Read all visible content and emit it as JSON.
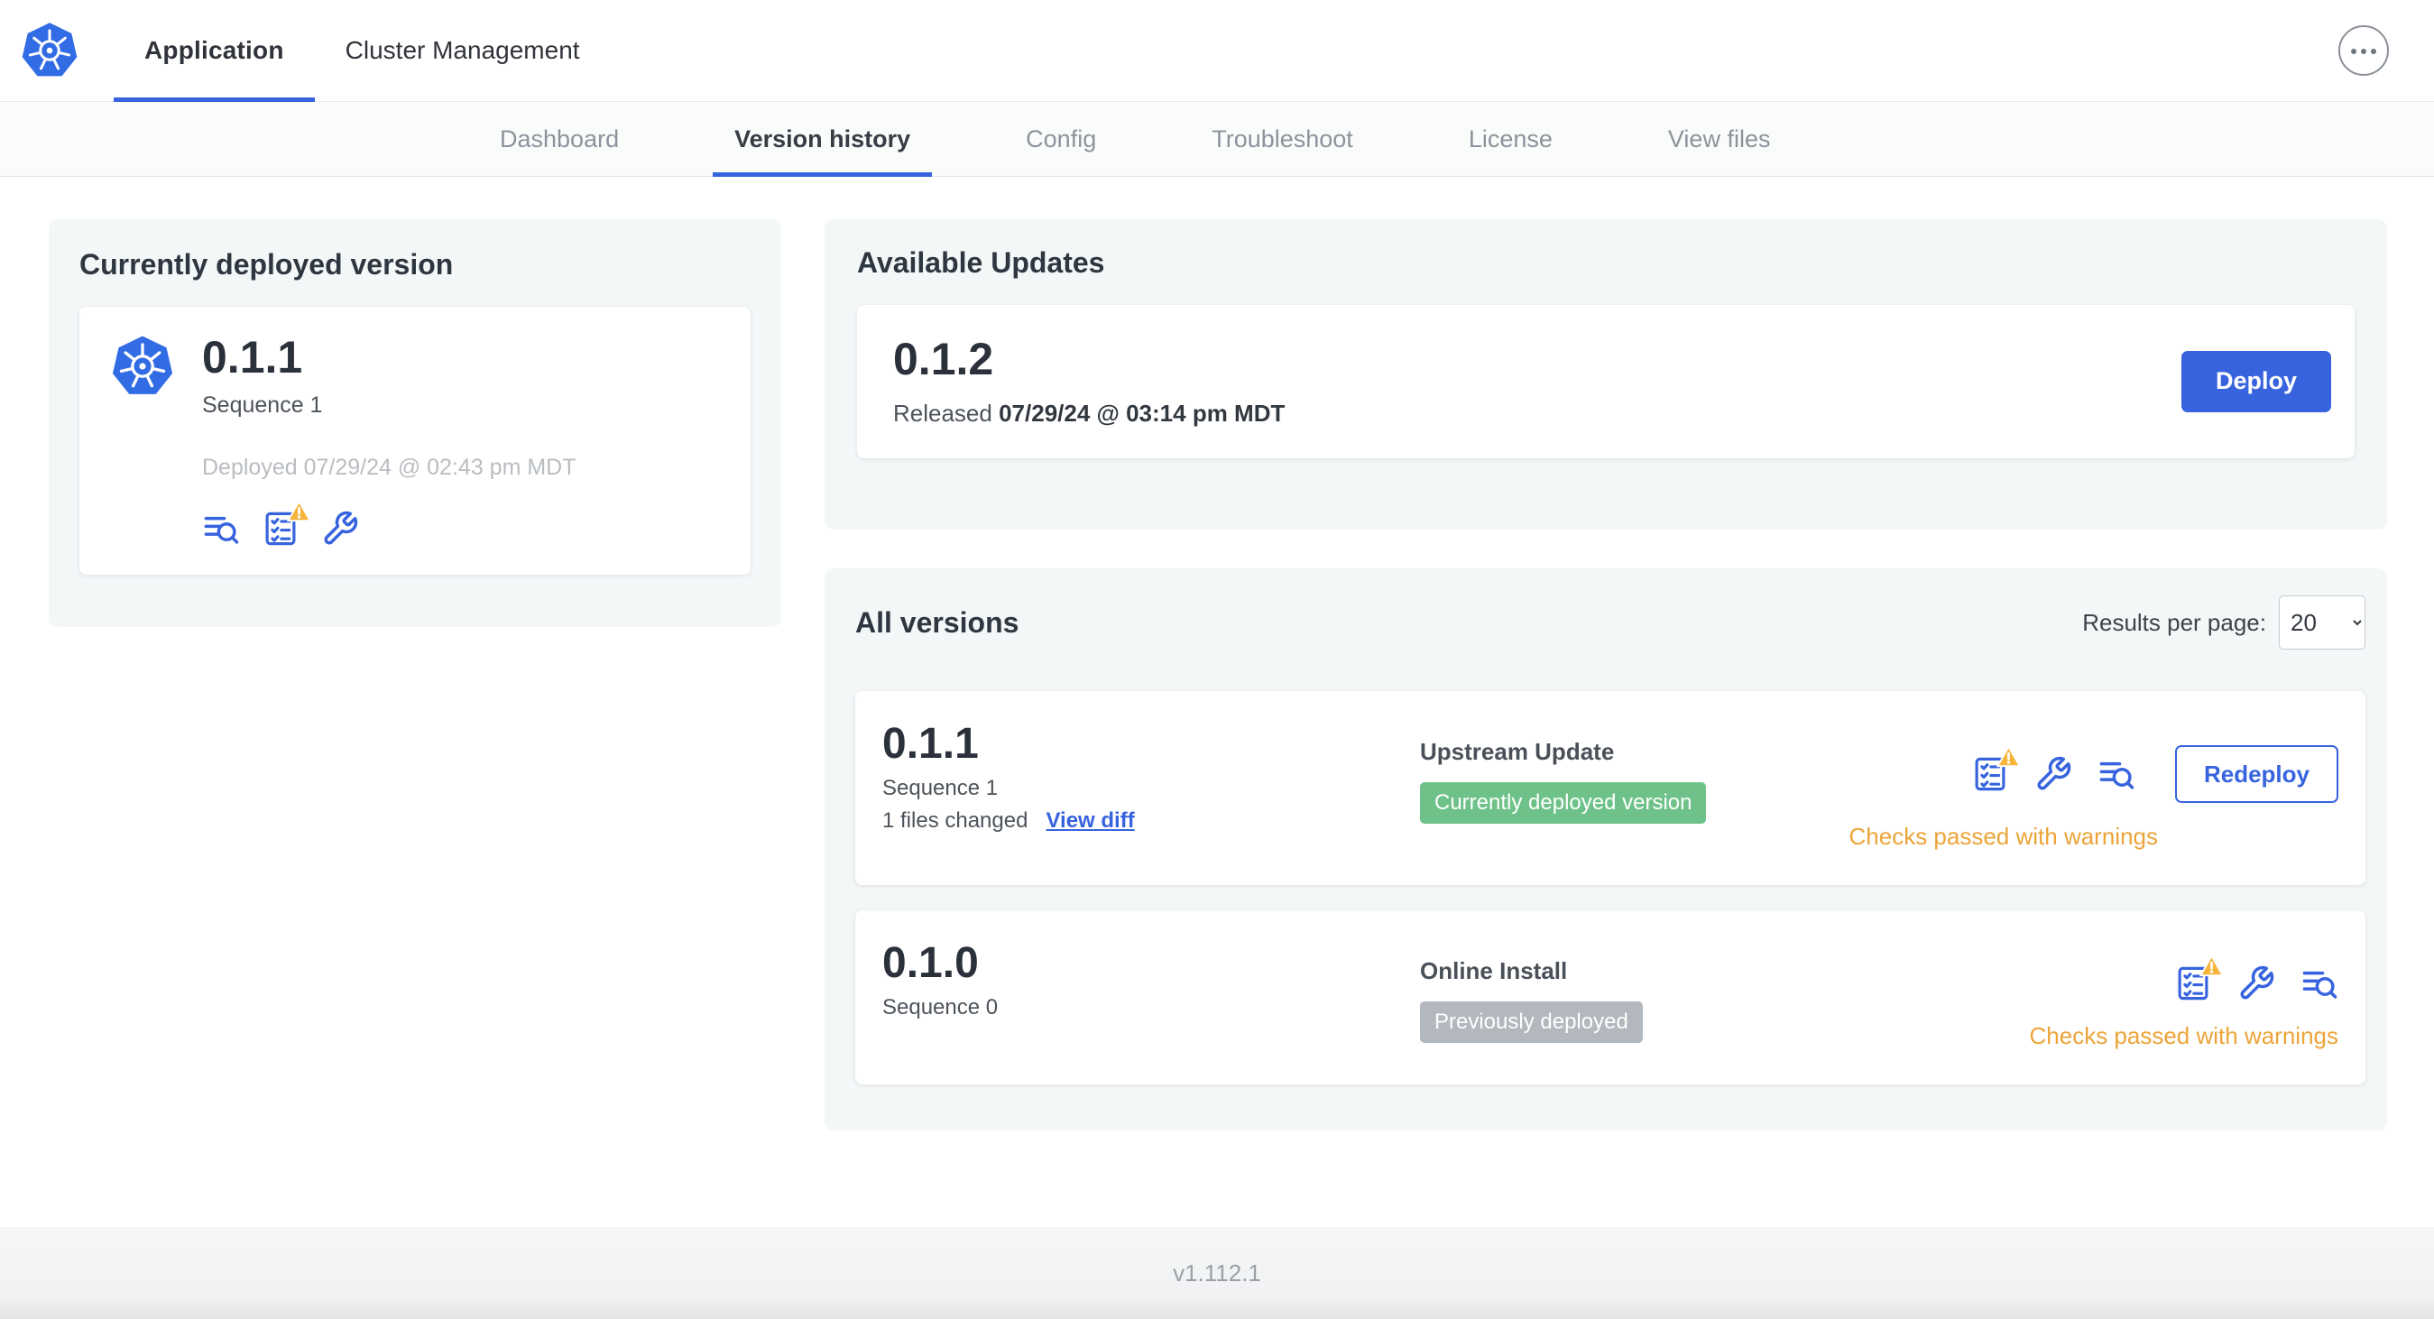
{
  "colors": {
    "accent": "#3764DE",
    "kubernetes_blue": "#326CE5",
    "badge_green": "#6EC289",
    "badge_gray": "#B2B8BE",
    "warning_text": "#ECA438",
    "warning_triangle": "#F6B43B"
  },
  "icons": {
    "app_logo": "kubernetes-helm-wheel",
    "logs": "document-search-lines",
    "preflight": "checklist",
    "warning": "warning-triangle",
    "config": "wrench",
    "more": "ellipsis-circle"
  },
  "topnav": {
    "tabs": [
      {
        "label": "Application"
      },
      {
        "label": "Cluster Management"
      }
    ]
  },
  "subnav": {
    "tabs": [
      {
        "label": "Dashboard"
      },
      {
        "label": "Version history"
      },
      {
        "label": "Config"
      },
      {
        "label": "Troubleshoot"
      },
      {
        "label": "License"
      },
      {
        "label": "View files"
      }
    ],
    "active": "Version history"
  },
  "current_version": {
    "title": "Currently deployed version",
    "version": "0.1.1",
    "sequence": "Sequence 1",
    "deployed": "Deployed 07/29/24 @ 02:43 pm MDT"
  },
  "available_updates": {
    "title": "Available Updates",
    "version": "0.1.2",
    "released_prefix": "Released",
    "released_date": "07/29/24 @ 03:14 pm MDT",
    "deploy_label": "Deploy"
  },
  "all_versions": {
    "title": "All versions",
    "results_per_page_label": "Results per page:",
    "results_per_page_value": "20",
    "rows": [
      {
        "version": "0.1.1",
        "sequence": "Sequence 1",
        "files_changed": "1 files changed",
        "view_diff": "View diff",
        "source": "Upstream Update",
        "badge": "Currently deployed version",
        "action": "Redeploy",
        "status": "Checks passed with warnings"
      },
      {
        "version": "0.1.0",
        "sequence": "Sequence 0",
        "source": "Online Install",
        "badge": "Previously deployed",
        "status": "Checks passed with warnings"
      }
    ]
  },
  "footer": {
    "version": "v1.112.1"
  }
}
